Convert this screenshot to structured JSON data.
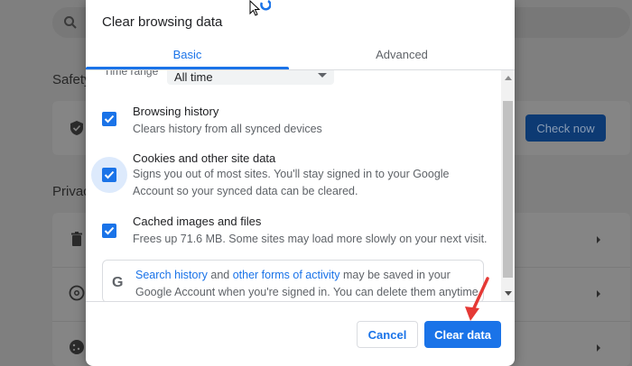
{
  "background": {
    "section_safety": "Safety",
    "section_privacy": "Privacy",
    "check_now_label": "Check now"
  },
  "dialog": {
    "title": "Clear browsing data",
    "tabs": [
      {
        "label": "Basic",
        "selected": true
      },
      {
        "label": "Advanced",
        "selected": false
      }
    ],
    "time_range": {
      "label": "Time range",
      "value": "All time"
    },
    "options": [
      {
        "title": "Browsing history",
        "description": "Clears history from all synced devices",
        "checked": true
      },
      {
        "title": "Cookies and other site data",
        "description": "Signs you out of most sites. You'll stay signed in to your Google Account so your synced data can be cleared.",
        "checked": true
      },
      {
        "title": "Cached images and files",
        "description": "Frees up 71.6 MB. Some sites may load more slowly on your next visit.",
        "checked": true
      }
    ],
    "info": {
      "link1": "Search history",
      "and": " and ",
      "link2": "other forms of activity",
      "rest": " may be saved in your Google Account when you're signed in. You can delete them anytime.",
      "icon": "google-g-icon"
    },
    "buttons": {
      "cancel": "Cancel",
      "clear": "Clear data"
    }
  },
  "colors": {
    "accent": "#1a73e8",
    "annotation_arrow": "#e53935"
  }
}
